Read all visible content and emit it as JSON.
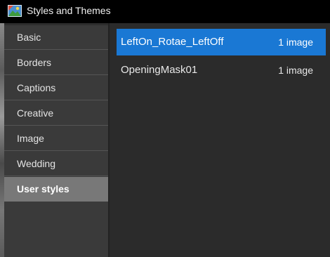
{
  "window": {
    "title": "Styles and Themes",
    "icon": "app-icon"
  },
  "sidebar": {
    "items": [
      {
        "label": "Basic"
      },
      {
        "label": "Borders"
      },
      {
        "label": "Captions"
      },
      {
        "label": "Creative"
      },
      {
        "label": "Image"
      },
      {
        "label": "Wedding"
      },
      {
        "label": "User styles"
      }
    ],
    "selected": "User styles"
  },
  "styles": {
    "rows": [
      {
        "name": "LeftOn_Rotae_LeftOff",
        "count": "1 image"
      },
      {
        "name": "OpeningMask01",
        "count": "1 image"
      }
    ],
    "selected": "LeftOn_Rotae_LeftOff"
  },
  "colors": {
    "accent": "#1a78d4",
    "selected_sidebar": "#787878",
    "titlebar": "#000000"
  }
}
